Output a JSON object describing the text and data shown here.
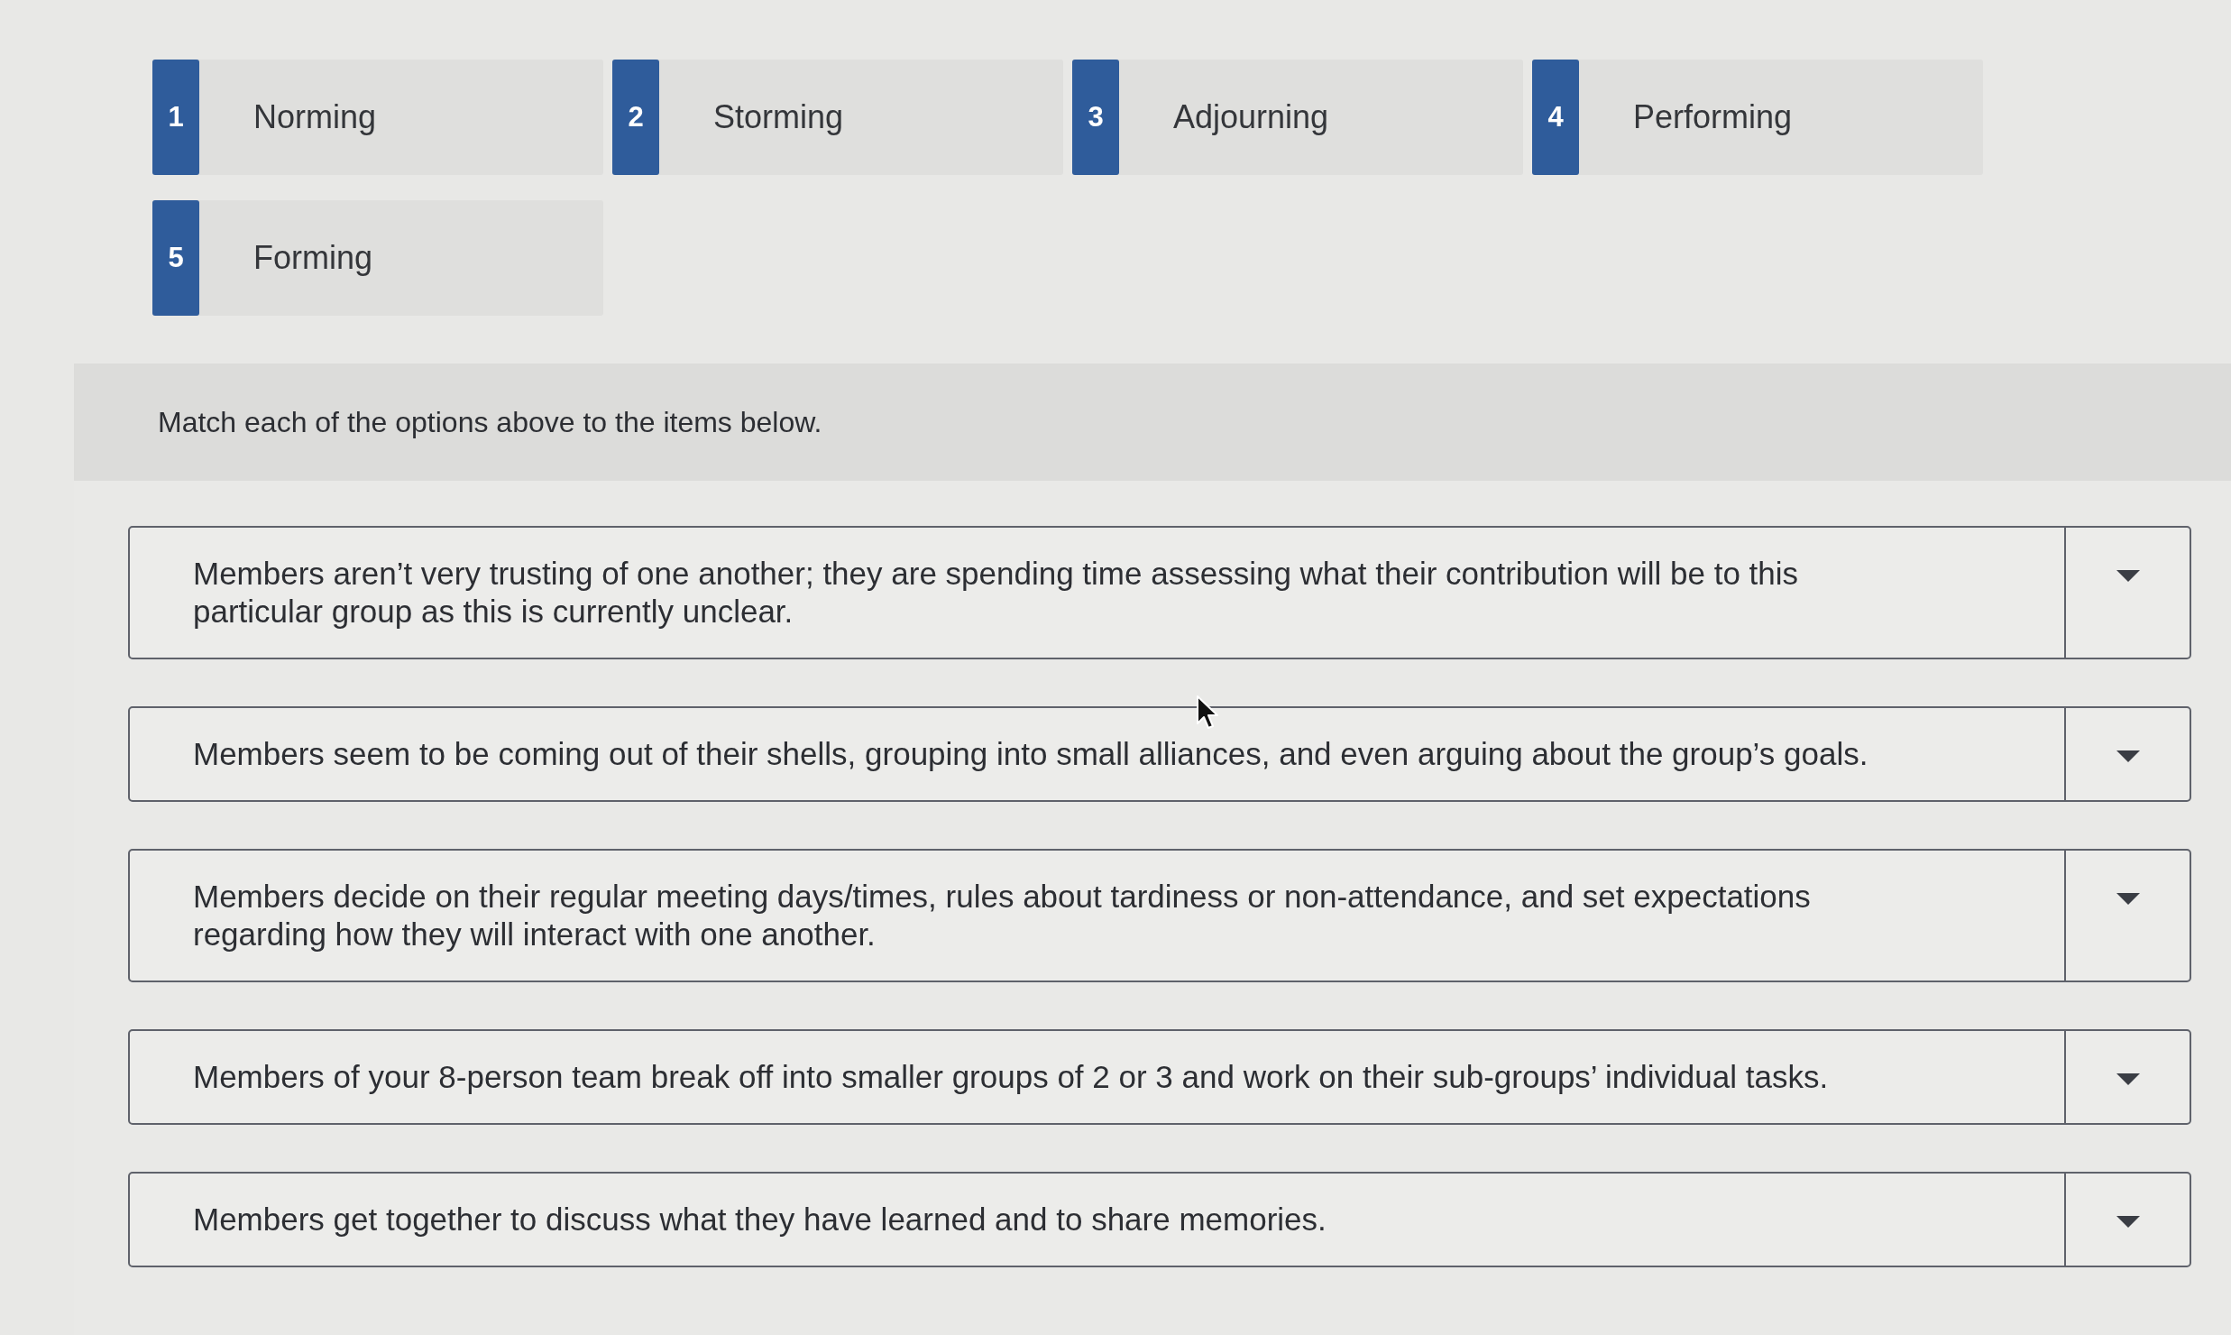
{
  "options": [
    {
      "number": "1",
      "label": "Norming"
    },
    {
      "number": "2",
      "label": "Storming"
    },
    {
      "number": "3",
      "label": "Adjourning"
    },
    {
      "number": "4",
      "label": "Performing"
    },
    {
      "number": "5",
      "label": "Forming"
    }
  ],
  "instructions": "Match each of the options above to the items below.",
  "items": [
    {
      "text": "Members aren’t very trusting of one another; they are spending time assessing what their contribution will be to this particular group as this is currently unclear."
    },
    {
      "text": "Members seem to be coming out of their shells, grouping into small alliances, and even arguing about the group’s goals."
    },
    {
      "text": "Members decide on their regular meeting days/times, rules about tardiness or non-attendance, and set expectations regarding how they will interact with one another."
    },
    {
      "text": "Members of your 8-person team break off into smaller groups of 2 or 3 and work on their sub-groups’ individual tasks."
    },
    {
      "text": "Members get together to discuss what they have learned and to share memories."
    }
  ]
}
